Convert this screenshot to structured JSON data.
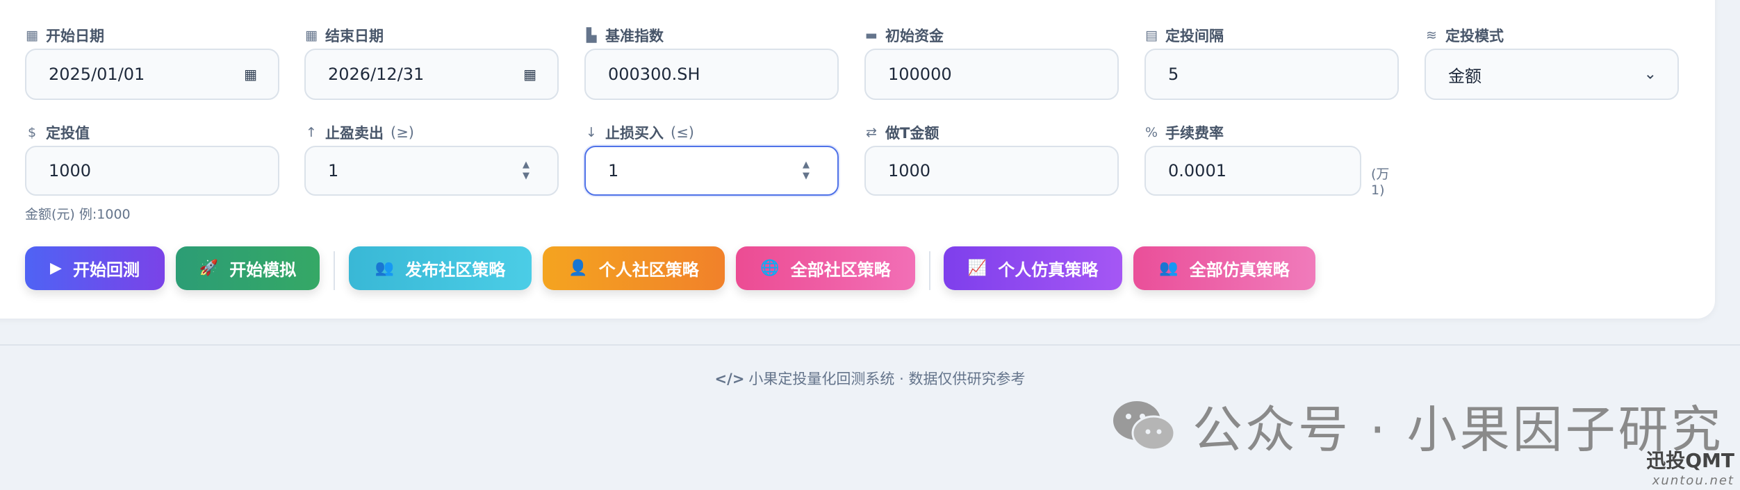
{
  "form": {
    "start_date": {
      "label": "开始日期",
      "value": "2025/01/01",
      "icon": "calendar-icon"
    },
    "end_date": {
      "label": "结束日期",
      "value": "2026/12/31",
      "icon": "calendar-icon"
    },
    "benchmark": {
      "label": "基准指数",
      "value": "000300.SH",
      "icon": "bar-chart-icon"
    },
    "initial_capital": {
      "label": "初始资金",
      "value": "100000",
      "icon": "wallet-icon"
    },
    "interval": {
      "label": "定投间隔",
      "value": "5",
      "icon": "calendar-icon"
    },
    "mode": {
      "label": "定投模式",
      "value": "金额",
      "icon": "coins-icon"
    },
    "invest_value": {
      "label": "定投值",
      "value": "1000",
      "icon": "dollar-icon",
      "hint": "金额(元) 例:1000"
    },
    "take_profit": {
      "label": "止盈卖出",
      "label_suffix": "(≥)",
      "value": "1",
      "icon": "arrow-up-icon"
    },
    "stop_loss": {
      "label": "止损买入",
      "label_suffix": "(≤)",
      "value": "1",
      "icon": "arrow-down-icon"
    },
    "t_amount": {
      "label": "做T金额",
      "value": "1000",
      "icon": "exchange-icon"
    },
    "fee_rate": {
      "label": "手续费率",
      "value": "0.0001",
      "unit": "(万1)",
      "icon": "percent-icon"
    }
  },
  "buttons": {
    "start_backtest": {
      "label": "开始回测",
      "icon": "play-icon",
      "color": "#5b5ef4"
    },
    "start_simulation": {
      "label": "开始模拟",
      "icon": "rocket-icon",
      "color": "#2f9f6f"
    },
    "publish_community": {
      "label": "发布社区策略",
      "icon": "users-icon",
      "color": "#3fc3dd"
    },
    "personal_community": {
      "label": "个人社区策略",
      "icon": "user-plus-icon",
      "color": "#f39224"
    },
    "all_community": {
      "label": "全部社区策略",
      "icon": "globe-icon",
      "color": "#ea5ca4"
    },
    "personal_sim": {
      "label": "个人仿真策略",
      "icon": "line-chart-icon",
      "color": "#8b4cf0"
    },
    "all_sim": {
      "label": "全部仿真策略",
      "icon": "users-icon",
      "color": "#ea5ca4"
    }
  },
  "footer": {
    "code_glyph": "</>",
    "text": "小果定投量化回测系统 · 数据仅供研究参考"
  },
  "watermark": {
    "title": "公众号 · 小果因子研究",
    "brand": "迅投QMT",
    "brand_url": "xuntou.net"
  }
}
